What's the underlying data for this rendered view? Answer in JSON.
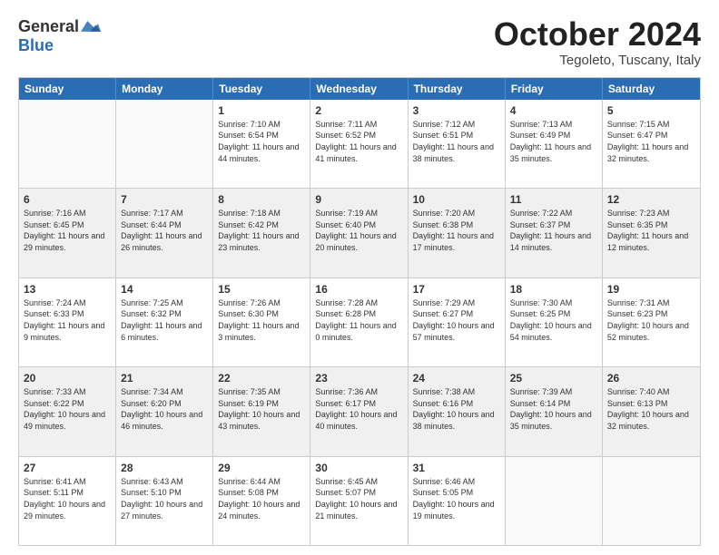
{
  "header": {
    "logo_general": "General",
    "logo_blue": "Blue",
    "month_title": "October 2024",
    "location": "Tegoleto, Tuscany, Italy"
  },
  "weekdays": [
    "Sunday",
    "Monday",
    "Tuesday",
    "Wednesday",
    "Thursday",
    "Friday",
    "Saturday"
  ],
  "rows": [
    [
      {
        "day": "",
        "content": "",
        "empty": true
      },
      {
        "day": "",
        "content": "",
        "empty": true
      },
      {
        "day": "1",
        "content": "Sunrise: 7:10 AM\nSunset: 6:54 PM\nDaylight: 11 hours and 44 minutes.",
        "shaded": false
      },
      {
        "day": "2",
        "content": "Sunrise: 7:11 AM\nSunset: 6:52 PM\nDaylight: 11 hours and 41 minutes.",
        "shaded": false
      },
      {
        "day": "3",
        "content": "Sunrise: 7:12 AM\nSunset: 6:51 PM\nDaylight: 11 hours and 38 minutes.",
        "shaded": false
      },
      {
        "day": "4",
        "content": "Sunrise: 7:13 AM\nSunset: 6:49 PM\nDaylight: 11 hours and 35 minutes.",
        "shaded": false
      },
      {
        "day": "5",
        "content": "Sunrise: 7:15 AM\nSunset: 6:47 PM\nDaylight: 11 hours and 32 minutes.",
        "shaded": false
      }
    ],
    [
      {
        "day": "6",
        "content": "Sunrise: 7:16 AM\nSunset: 6:45 PM\nDaylight: 11 hours and 29 minutes.",
        "shaded": true
      },
      {
        "day": "7",
        "content": "Sunrise: 7:17 AM\nSunset: 6:44 PM\nDaylight: 11 hours and 26 minutes.",
        "shaded": true
      },
      {
        "day": "8",
        "content": "Sunrise: 7:18 AM\nSunset: 6:42 PM\nDaylight: 11 hours and 23 minutes.",
        "shaded": true
      },
      {
        "day": "9",
        "content": "Sunrise: 7:19 AM\nSunset: 6:40 PM\nDaylight: 11 hours and 20 minutes.",
        "shaded": true
      },
      {
        "day": "10",
        "content": "Sunrise: 7:20 AM\nSunset: 6:38 PM\nDaylight: 11 hours and 17 minutes.",
        "shaded": true
      },
      {
        "day": "11",
        "content": "Sunrise: 7:22 AM\nSunset: 6:37 PM\nDaylight: 11 hours and 14 minutes.",
        "shaded": true
      },
      {
        "day": "12",
        "content": "Sunrise: 7:23 AM\nSunset: 6:35 PM\nDaylight: 11 hours and 12 minutes.",
        "shaded": true
      }
    ],
    [
      {
        "day": "13",
        "content": "Sunrise: 7:24 AM\nSunset: 6:33 PM\nDaylight: 11 hours and 9 minutes.",
        "shaded": false
      },
      {
        "day": "14",
        "content": "Sunrise: 7:25 AM\nSunset: 6:32 PM\nDaylight: 11 hours and 6 minutes.",
        "shaded": false
      },
      {
        "day": "15",
        "content": "Sunrise: 7:26 AM\nSunset: 6:30 PM\nDaylight: 11 hours and 3 minutes.",
        "shaded": false
      },
      {
        "day": "16",
        "content": "Sunrise: 7:28 AM\nSunset: 6:28 PM\nDaylight: 11 hours and 0 minutes.",
        "shaded": false
      },
      {
        "day": "17",
        "content": "Sunrise: 7:29 AM\nSunset: 6:27 PM\nDaylight: 10 hours and 57 minutes.",
        "shaded": false
      },
      {
        "day": "18",
        "content": "Sunrise: 7:30 AM\nSunset: 6:25 PM\nDaylight: 10 hours and 54 minutes.",
        "shaded": false
      },
      {
        "day": "19",
        "content": "Sunrise: 7:31 AM\nSunset: 6:23 PM\nDaylight: 10 hours and 52 minutes.",
        "shaded": false
      }
    ],
    [
      {
        "day": "20",
        "content": "Sunrise: 7:33 AM\nSunset: 6:22 PM\nDaylight: 10 hours and 49 minutes.",
        "shaded": true
      },
      {
        "day": "21",
        "content": "Sunrise: 7:34 AM\nSunset: 6:20 PM\nDaylight: 10 hours and 46 minutes.",
        "shaded": true
      },
      {
        "day": "22",
        "content": "Sunrise: 7:35 AM\nSunset: 6:19 PM\nDaylight: 10 hours and 43 minutes.",
        "shaded": true
      },
      {
        "day": "23",
        "content": "Sunrise: 7:36 AM\nSunset: 6:17 PM\nDaylight: 10 hours and 40 minutes.",
        "shaded": true
      },
      {
        "day": "24",
        "content": "Sunrise: 7:38 AM\nSunset: 6:16 PM\nDaylight: 10 hours and 38 minutes.",
        "shaded": true
      },
      {
        "day": "25",
        "content": "Sunrise: 7:39 AM\nSunset: 6:14 PM\nDaylight: 10 hours and 35 minutes.",
        "shaded": true
      },
      {
        "day": "26",
        "content": "Sunrise: 7:40 AM\nSunset: 6:13 PM\nDaylight: 10 hours and 32 minutes.",
        "shaded": true
      }
    ],
    [
      {
        "day": "27",
        "content": "Sunrise: 6:41 AM\nSunset: 5:11 PM\nDaylight: 10 hours and 29 minutes.",
        "shaded": false
      },
      {
        "day": "28",
        "content": "Sunrise: 6:43 AM\nSunset: 5:10 PM\nDaylight: 10 hours and 27 minutes.",
        "shaded": false
      },
      {
        "day": "29",
        "content": "Sunrise: 6:44 AM\nSunset: 5:08 PM\nDaylight: 10 hours and 24 minutes.",
        "shaded": false
      },
      {
        "day": "30",
        "content": "Sunrise: 6:45 AM\nSunset: 5:07 PM\nDaylight: 10 hours and 21 minutes.",
        "shaded": false
      },
      {
        "day": "31",
        "content": "Sunrise: 6:46 AM\nSunset: 5:05 PM\nDaylight: 10 hours and 19 minutes.",
        "shaded": false
      },
      {
        "day": "",
        "content": "",
        "empty": true
      },
      {
        "day": "",
        "content": "",
        "empty": true
      }
    ]
  ]
}
